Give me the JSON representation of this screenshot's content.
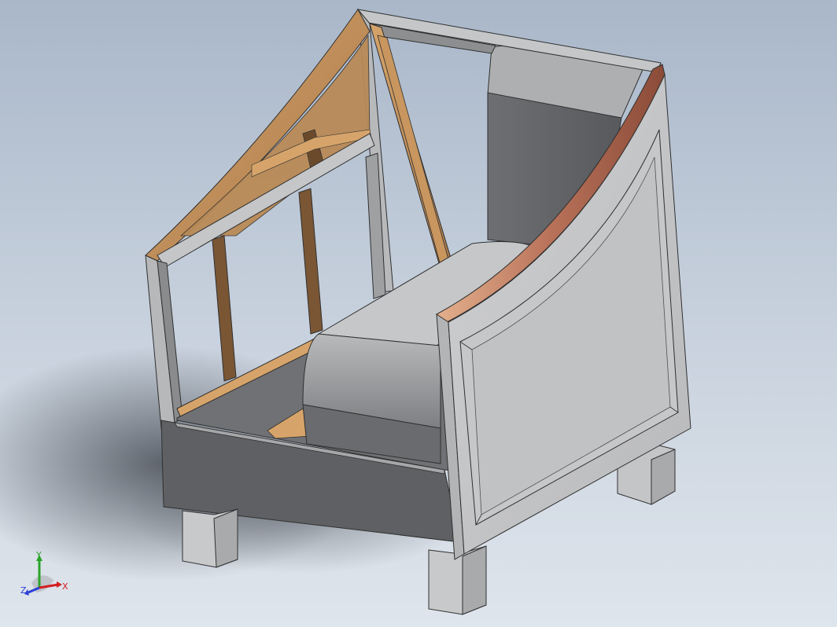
{
  "viewport": {
    "background_top": "#a9b7c9",
    "background_bottom": "#dfe5ec"
  },
  "model": {
    "colors": {
      "gray_light": "#c7c8ca",
      "gray_mid": "#9fa0a2",
      "gray_dark": "#5f6063",
      "wood_light": "#d6a46a",
      "wood_mid": "#a8784a",
      "wood_dark": "#6b4a2c",
      "edge": "#303030"
    }
  },
  "triad": {
    "x_label": "X",
    "y_label": "Y",
    "z_label": "Z",
    "x_color": "#d21e1e",
    "y_color": "#2aa52a",
    "z_color": "#2b3fd6"
  }
}
